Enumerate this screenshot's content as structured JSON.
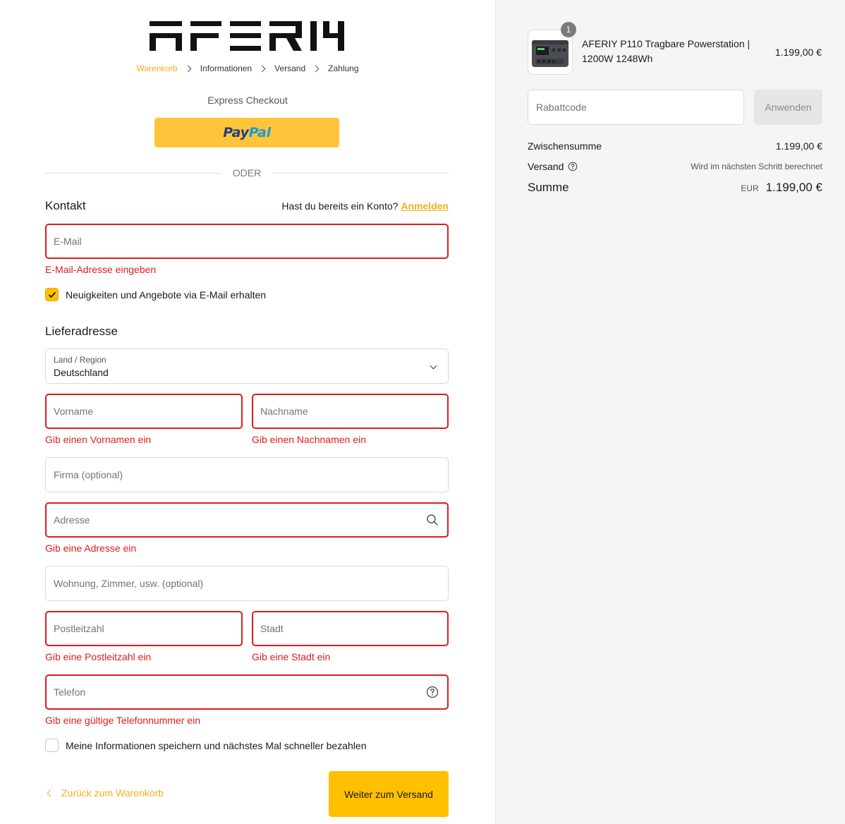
{
  "brand": {
    "logo_text": "AFERIY"
  },
  "breadcrumb": {
    "items": [
      "Warenkorb",
      "Informationen",
      "Versand",
      "Zahlung"
    ]
  },
  "express": {
    "label": "Express Checkout",
    "paypal_part1": "Pay",
    "paypal_part2": "Pal",
    "divider": "ODER"
  },
  "contact": {
    "title": "Kontakt",
    "account_question": "Hast du bereits ein Konto?",
    "login_link": "Anmelden",
    "email_placeholder": "E-Mail",
    "email_error": "E-Mail-Adresse eingeben",
    "newsletter_label": "Neuigkeiten und Angebote via E-Mail erhalten",
    "newsletter_checked": true
  },
  "shipping": {
    "title": "Lieferadresse",
    "country_label": "Land / Region",
    "country_value": "Deutschland",
    "first_name_placeholder": "Vorname",
    "first_name_error": "Gib einen Vornamen ein",
    "last_name_placeholder": "Nachname",
    "last_name_error": "Gib einen Nachnamen ein",
    "company_placeholder": "Firma (optional)",
    "address_placeholder": "Adresse",
    "address_error": "Gib eine Adresse ein",
    "apartment_placeholder": "Wohnung, Zimmer, usw. (optional)",
    "zip_placeholder": "Postleitzahl",
    "zip_error": "Gib eine Postleitzahl ein",
    "city_placeholder": "Stadt",
    "city_error": "Gib eine Stadt ein",
    "phone_placeholder": "Telefon",
    "phone_error": "Gib eine gültige Telefonnummer ein",
    "save_info_label": "Meine Informationen speichern und nächstes Mal schneller bezahlen",
    "save_info_checked": false
  },
  "actions": {
    "back_label": "Zurück zum Warenkorb",
    "continue_label": "Weiter zum Versand"
  },
  "summary": {
    "product": {
      "quantity": "1",
      "title": "AFERIY P110 Tragbare Powerstation | 1200W 1248Wh",
      "price": "1.199,00 €"
    },
    "discount_placeholder": "Rabattcode",
    "apply_label": "Anwenden",
    "subtotal_label": "Zwischensumme",
    "subtotal_value": "1.199,00 €",
    "shipping_label": "Versand",
    "shipping_value": "Wird im nächsten Schritt berechnet",
    "total_label": "Summe",
    "total_currency": "EUR",
    "total_value": "1.199,00 €"
  },
  "colors": {
    "accent": "#ffc000",
    "link": "#f2b01e",
    "error": "#dd1d1d",
    "paypal_yellow": "#ffc439"
  }
}
